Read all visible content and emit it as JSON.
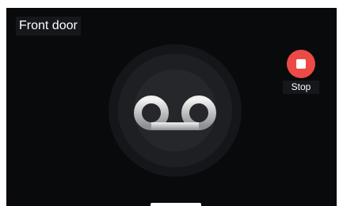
{
  "header": {
    "title": "Front door"
  },
  "status": {
    "icon": "voicemail-icon"
  },
  "controls": {
    "stop_label": "Stop",
    "stop_icon": "stop-icon",
    "stop_color": "#ec4a47"
  },
  "colors": {
    "background": "#090a0c",
    "ring": "#1e1f23"
  }
}
